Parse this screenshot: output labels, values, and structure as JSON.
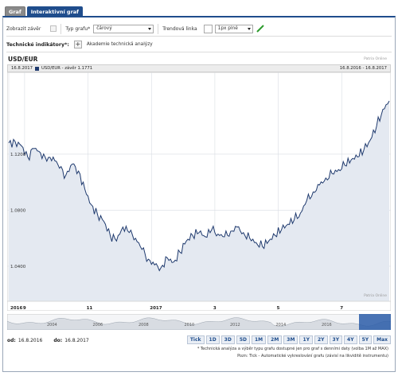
{
  "tabs": [
    {
      "label": "Graf",
      "active": false
    },
    {
      "label": "Interaktivní graf",
      "active": true
    }
  ],
  "toolbar": {
    "show_close_label": "Zobrazit závěr",
    "chart_type_label": "Typ grafu*",
    "chart_type_value": "čárový",
    "trend_label": "Trendová linka",
    "trend_value": "1px plné"
  },
  "tech": {
    "label": "Technické indikátory*:",
    "add": "+",
    "link": "Akademie technická analýzy"
  },
  "chart_header": {
    "pair": "USD/EUR",
    "brand": "Patria Online",
    "info_date": "16.8.2017",
    "info_series": "USD/EUR - závěr 1.1771",
    "info_range": "16.8.2016 - 16.8.2017"
  },
  "colors": {
    "line": "#1f3a6e",
    "area": "#e4e9f1",
    "tab_active": "#1f4d8c",
    "grid": "#d9dde3"
  },
  "chart_data": {
    "type": "line",
    "title": "USD/EUR",
    "xlabel": "",
    "ylabel": "",
    "ylim": [
      1.015,
      1.175
    ],
    "y_ticks": [
      "1.1200",
      "1.0800",
      "1.0400"
    ],
    "y_tick_values": [
      1.12,
      1.08,
      1.04
    ],
    "x_ticks": [
      "2016",
      "9",
      "11",
      "2017",
      "3",
      "5",
      "7"
    ],
    "x_tick_positions": [
      0,
      0.5,
      2.5,
      4.5,
      6.5,
      8.5,
      10.5
    ],
    "x_range": [
      0,
      12
    ],
    "series": [
      {
        "name": "USD/EUR - závěr",
        "x": [
          0,
          0.2,
          0.4,
          0.6,
          0.8,
          1.0,
          1.2,
          1.4,
          1.6,
          1.8,
          2.0,
          2.2,
          2.4,
          2.6,
          2.8,
          3.0,
          3.2,
          3.4,
          3.6,
          3.8,
          4.0,
          4.2,
          4.4,
          4.6,
          4.8,
          5.0,
          5.2,
          5.4,
          5.6,
          5.8,
          6.0,
          6.2,
          6.4,
          6.6,
          6.8,
          7.0,
          7.2,
          7.4,
          7.6,
          7.8,
          8.0,
          8.2,
          8.4,
          8.6,
          8.8,
          9.0,
          9.2,
          9.4,
          9.6,
          9.8,
          10.0,
          10.2,
          10.4,
          10.6,
          10.8,
          11.0,
          11.2,
          11.4,
          11.6,
          11.8,
          12.0
        ],
        "y": [
          1.128,
          1.129,
          1.126,
          1.118,
          1.124,
          1.121,
          1.115,
          1.118,
          1.11,
          1.105,
          1.113,
          1.108,
          1.095,
          1.084,
          1.077,
          1.072,
          1.062,
          1.058,
          1.068,
          1.064,
          1.06,
          1.052,
          1.045,
          1.041,
          1.039,
          1.046,
          1.043,
          1.05,
          1.058,
          1.062,
          1.064,
          1.061,
          1.066,
          1.063,
          1.061,
          1.065,
          1.068,
          1.064,
          1.06,
          1.057,
          1.054,
          1.058,
          1.062,
          1.066,
          1.07,
          1.073,
          1.078,
          1.087,
          1.093,
          1.098,
          1.103,
          1.106,
          1.109,
          1.112,
          1.116,
          1.118,
          1.123,
          1.13,
          1.14,
          1.152,
          1.158
        ]
      }
    ],
    "grid": true
  },
  "navigator": {
    "years": [
      "2004",
      "2006",
      "2008",
      "2010",
      "2012",
      "2014",
      "2016"
    ]
  },
  "dates": {
    "from_label": "od:",
    "from_value": "16.8.2016",
    "to_label": "do:",
    "to_value": "16.8.2017"
  },
  "ranges": [
    "Tick",
    "1D",
    "3D",
    "5D",
    "1M",
    "2M",
    "3M",
    "1Y",
    "2Y",
    "3Y",
    "4Y",
    "5Y",
    "Max"
  ],
  "notes": {
    "line1": "* Technická analýza a výběr typu grafu dostupné jen pro graf s denními daty (volba 1M až MAX)",
    "line2": "Pozn: Tick - Automatické vykreslování grafu (závisí na likviditě instrumentu)"
  }
}
